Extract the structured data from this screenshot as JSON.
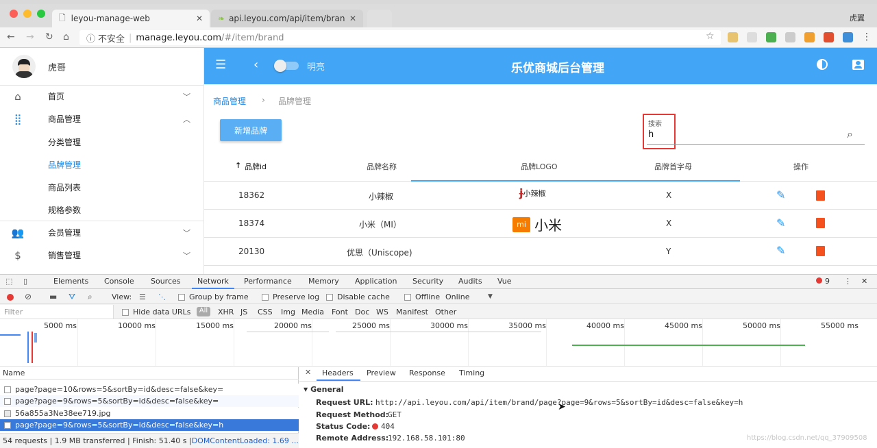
{
  "browser": {
    "tabs": [
      {
        "title": "leyou-manage-web"
      },
      {
        "title": "api.leyou.com/api/item/brand/p"
      }
    ],
    "profile": "虎翼",
    "insecure_label": "不安全",
    "url_host": "manage.leyou.com",
    "url_path": "/#/item/brand"
  },
  "sidebar": {
    "user_name": "虎哥",
    "items": [
      {
        "label": "首页",
        "icon": "home-icon"
      },
      {
        "label": "商品管理",
        "icon": "apps-icon"
      },
      {
        "label": "会员管理",
        "icon": "people-icon"
      },
      {
        "label": "销售管理",
        "icon": "dollar-icon"
      }
    ],
    "sub_items": [
      "分类管理",
      "品牌管理",
      "商品列表",
      "规格参数"
    ]
  },
  "appbar": {
    "title": "乐优商城后台管理",
    "theme_toggle_label": "明亮"
  },
  "breadcrumb": {
    "parent": "商品管理",
    "current": "品牌管理"
  },
  "toolbar": {
    "new_button": "新增品牌",
    "search_label": "搜索",
    "search_value": "h"
  },
  "table": {
    "headers": [
      "品牌id",
      "品牌名称",
      "品牌LOGO",
      "品牌首字母",
      "操作"
    ],
    "sort_indicator": "↑",
    "rows": [
      {
        "id": "18362",
        "name": "小辣椒",
        "letter": "X",
        "logo_text": "小辣椒"
      },
      {
        "id": "18374",
        "name": "小米（MI）",
        "letter": "X",
        "logo_text": "小米"
      },
      {
        "id": "20130",
        "name": "优思（Uniscope)",
        "letter": "Y",
        "logo_text": ""
      }
    ]
  },
  "devtools": {
    "tabs": [
      "Elements",
      "Console",
      "Sources",
      "Network",
      "Performance",
      "Memory",
      "Application",
      "Security",
      "Audits",
      "Vue"
    ],
    "active_tab": "Network",
    "error_count": "9",
    "view_label": "View:",
    "group_by_frame": "Group by frame",
    "preserve_log": "Preserve log",
    "disable_cache": "Disable cache",
    "offline": "Offline",
    "online": "Online",
    "filter_placeholder": "Filter",
    "hide_data_urls": "Hide data URLs",
    "all_label": "All",
    "filter_types": [
      "XHR",
      "JS",
      "CSS",
      "Img",
      "Media",
      "Font",
      "Doc",
      "WS",
      "Manifest",
      "Other"
    ],
    "timeline_labels": [
      "5000 ms",
      "10000 ms",
      "15000 ms",
      "20000 ms",
      "25000 ms",
      "30000 ms",
      "35000 ms",
      "40000 ms",
      "45000 ms",
      "50000 ms",
      "55000 ms"
    ],
    "name_header": "Name",
    "requests": [
      "page?page=10&rows=5&sortBy=id&desc=false&key=",
      "page?page=9&rows=5&sortBy=id&desc=false&key=",
      "56a855a3Ne38ee719.jpg",
      "page?page=9&rows=5&sortBy=id&desc=false&key=h"
    ],
    "summary": "54 requests | 1.9 MB transferred | Finish: 51.40 s | ",
    "dom_loaded": "DOMContentLoaded: 1.69 ...",
    "detail_tabs": [
      "Headers",
      "Preview",
      "Response",
      "Timing"
    ],
    "general_label": "General",
    "request_url_label": "Request URL:",
    "request_url": "http://api.leyou.com/api/item/brand/page?page=9&rows=5&sortBy=id&desc=false&key=h",
    "request_method_label": "Request Method:",
    "request_method": "GET",
    "status_code_label": "Status Code:",
    "status_code": "404",
    "remote_address_label": "Remote Address:",
    "remote_address": "192.168.58.101:80",
    "watermark": "https://blog.csdn.net/qq_37909508"
  },
  "colors": {
    "primary": "#42a5f5",
    "delete": "#f4511e",
    "edit": "#2196f3",
    "highlight": "#e53935"
  }
}
